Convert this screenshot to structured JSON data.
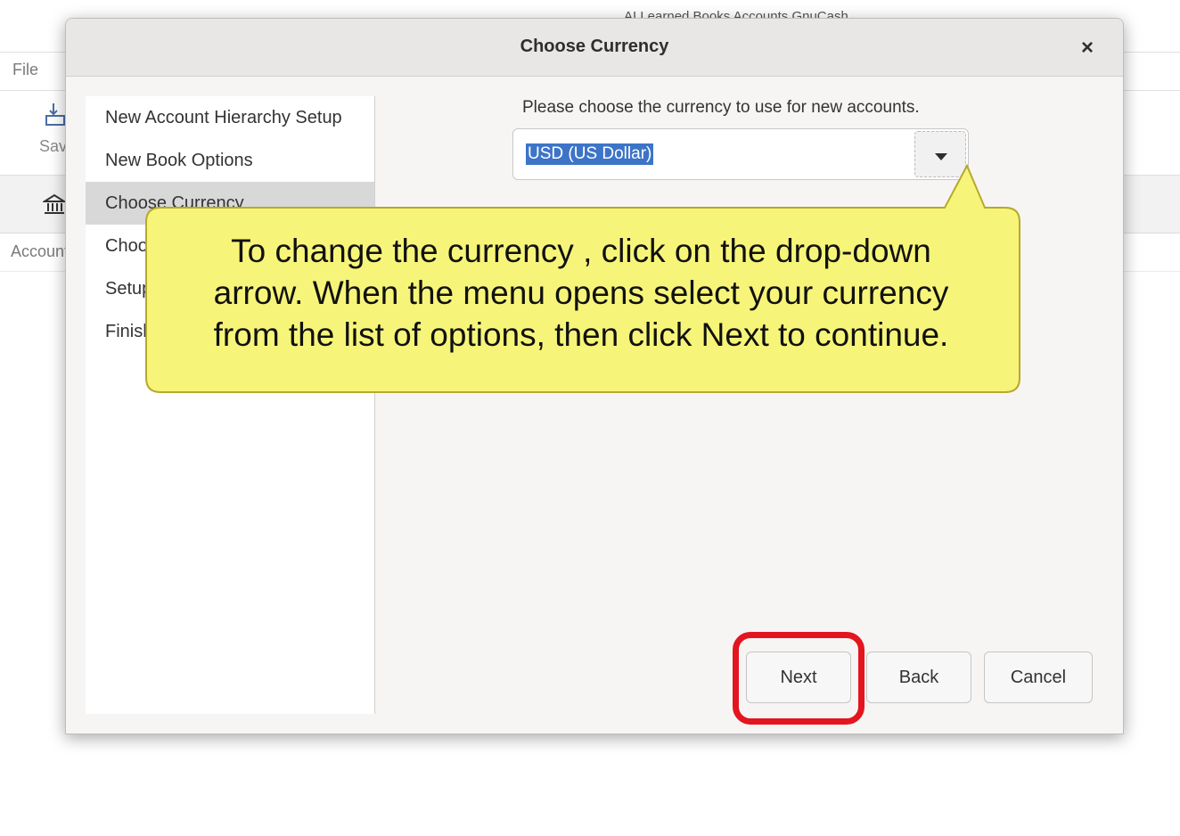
{
  "background": {
    "window_title": "AI Learned Books Accounts GnuCash",
    "menu_file": "File",
    "toolbar_save": "Save",
    "accounts_label": "Accounts"
  },
  "dialog": {
    "title": "Choose Currency",
    "close_icon": "close-icon",
    "sidebar": {
      "items": [
        {
          "label": "New Account Hierarchy Setup",
          "selected": false
        },
        {
          "label": "New Book Options",
          "selected": false
        },
        {
          "label": "Choose Currency",
          "selected": true
        },
        {
          "label": "Choose accounts to create",
          "selected": false
        },
        {
          "label": "Setup selected accounts",
          "selected": false
        },
        {
          "label": "Finish Account Setup",
          "selected": false
        }
      ]
    },
    "prompt": "Please choose the currency to use for new accounts.",
    "currency_select": {
      "value": "USD (US Dollar)",
      "arrow_icon": "chevron-down-icon"
    },
    "buttons": {
      "next": "Next",
      "back": "Back",
      "cancel": "Cancel"
    }
  },
  "callout": {
    "line1": "To change the currency , click on the drop-down",
    "line2": "arrow. When the menu opens select your currency",
    "line3": "from the list of options, then click Next to continue.",
    "fill_color": "#f7f579",
    "border_color": "#b6a92e"
  },
  "highlight": {
    "color": "#e3151f",
    "target": "Next"
  }
}
